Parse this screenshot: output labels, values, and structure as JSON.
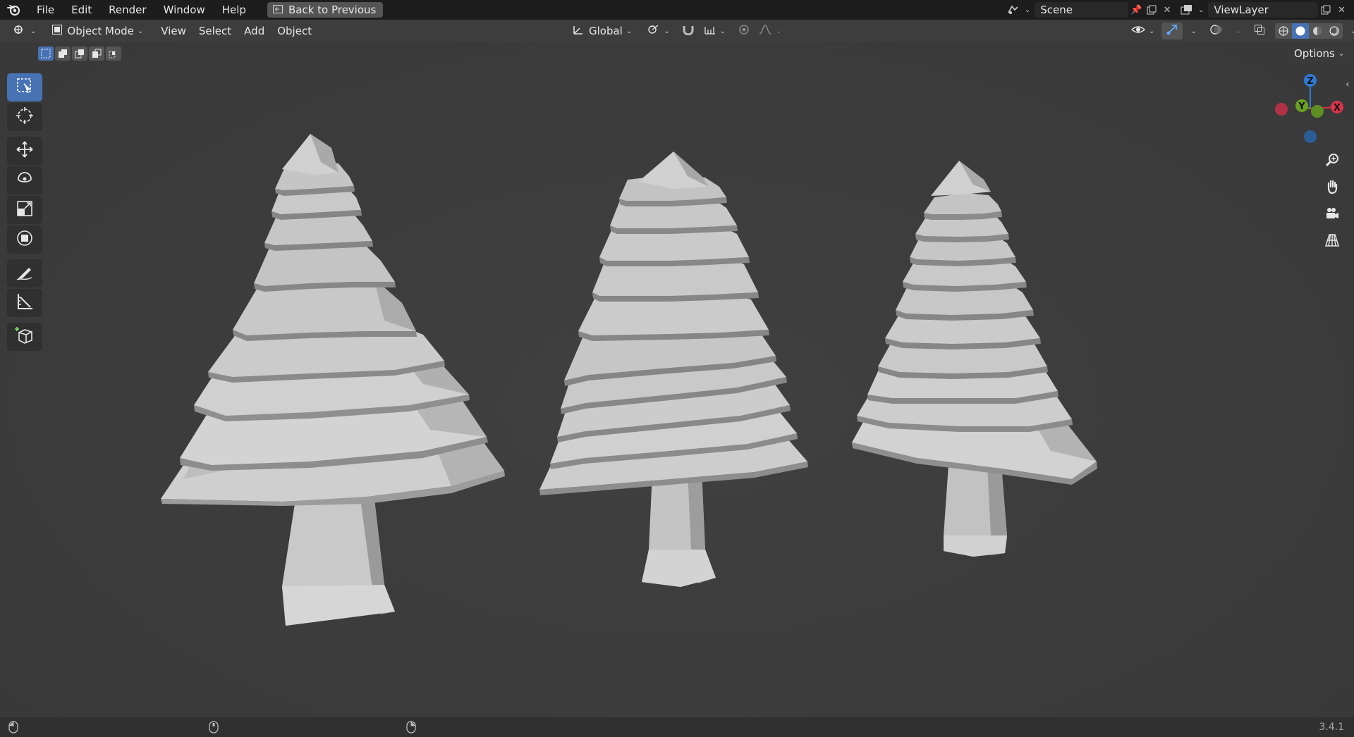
{
  "menu": {
    "items": [
      "File",
      "Edit",
      "Render",
      "Window",
      "Help"
    ],
    "back_label": "Back to Previous"
  },
  "scene": {
    "name": "Scene"
  },
  "view_layer": {
    "name": "ViewLayer"
  },
  "header": {
    "mode_label": "Object Mode",
    "menus": [
      "View",
      "Select",
      "Add",
      "Object"
    ],
    "transform_orientation": "Global",
    "options_label": "Options"
  },
  "gizmo": {
    "z": "Z",
    "y": "Y",
    "x": "X"
  },
  "status": {
    "version": "3.4.1"
  },
  "colors": {
    "accent": "#4772b3",
    "axis_x": "#d9334a",
    "axis_y": "#6aa120",
    "axis_z": "#2e7bd4",
    "viewport": "#3d3d3d"
  },
  "viewport_objects": [
    "tree-1",
    "tree-2",
    "tree-3"
  ]
}
